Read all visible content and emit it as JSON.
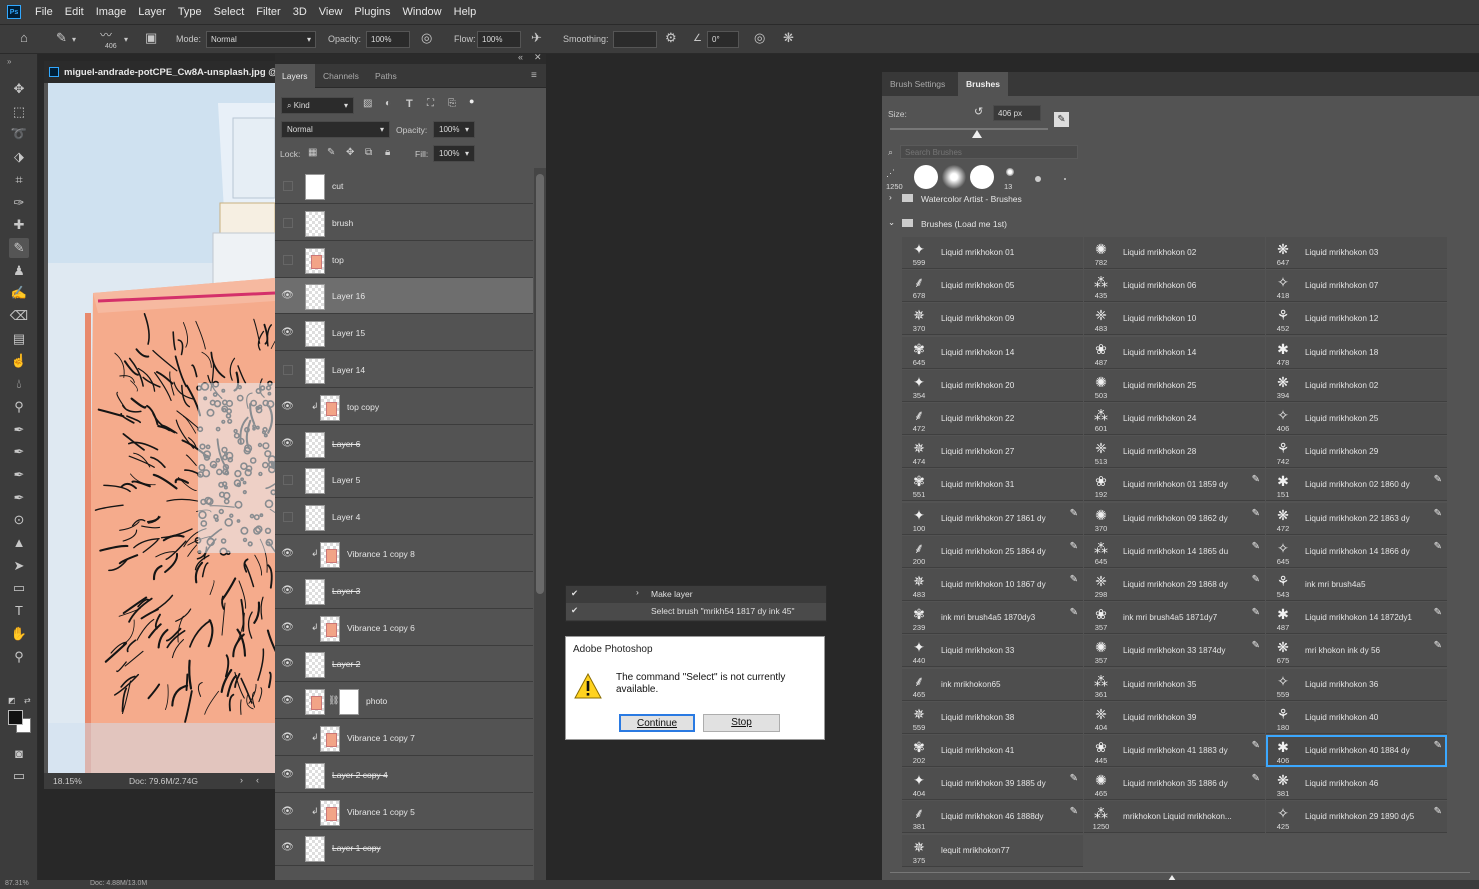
{
  "menubar": {
    "logo": "Ps",
    "items": [
      "File",
      "Edit",
      "Image",
      "Layer",
      "Type",
      "Select",
      "Filter",
      "3D",
      "View",
      "Plugins",
      "Window",
      "Help"
    ]
  },
  "options": {
    "brush_size": "406",
    "mode_label": "Mode:",
    "mode_value": "Normal",
    "opacity_label": "Opacity:",
    "opacity_value": "100%",
    "flow_label": "Flow:",
    "flow_value": "100%",
    "smoothing_label": "Smoothing:",
    "smoothing_value": "",
    "angle_value": "0°"
  },
  "document": {
    "tab_title": "miguel-andrade-potCPE_Cw8A-unsplash.jpg @",
    "zoom": "18.15%",
    "doc_size": "Doc: 79.6M/2.74G",
    "colors": {
      "canvas_bg": "#dfe9f2",
      "bottle": "#f5ab8c",
      "ink": "#151515"
    }
  },
  "layers_panel": {
    "tabs": [
      "Layers",
      "Channels",
      "Paths"
    ],
    "kind_filter": "Kind",
    "blend_mode": "Normal",
    "opacity_label": "Opacity:",
    "opacity_value": "100%",
    "lock_label": "Lock:",
    "fill_label": "Fill:",
    "fill_value": "100%",
    "layers": [
      {
        "name": "cut",
        "visible": false,
        "thumb": "white",
        "clip": false,
        "strike": false
      },
      {
        "name": "brush",
        "visible": false,
        "thumb": "checker",
        "clip": false,
        "strike": false
      },
      {
        "name": "top",
        "visible": false,
        "thumb": "peach",
        "clip": false,
        "strike": false
      },
      {
        "name": "Layer 16",
        "visible": true,
        "thumb": "checker",
        "clip": false,
        "strike": false,
        "selected": true
      },
      {
        "name": "Layer 15",
        "visible": true,
        "thumb": "checker",
        "clip": false,
        "strike": false
      },
      {
        "name": "Layer 14",
        "visible": false,
        "thumb": "checker",
        "clip": false,
        "strike": false
      },
      {
        "name": "top copy",
        "visible": true,
        "thumb": "peach",
        "clip": true,
        "strike": false
      },
      {
        "name": "Layer 6",
        "visible": true,
        "thumb": "checker",
        "clip": false,
        "strike": true
      },
      {
        "name": "Layer 5",
        "visible": false,
        "thumb": "checker",
        "clip": false,
        "strike": false
      },
      {
        "name": "Layer 4",
        "visible": false,
        "thumb": "checker",
        "clip": false,
        "strike": false
      },
      {
        "name": "Vibrance 1 copy 8",
        "visible": true,
        "thumb": "peach",
        "clip": true,
        "strike": false
      },
      {
        "name": "Layer 3",
        "visible": true,
        "thumb": "checker",
        "clip": false,
        "strike": true
      },
      {
        "name": "Vibrance 1 copy 6",
        "visible": true,
        "thumb": "peach",
        "clip": true,
        "strike": false
      },
      {
        "name": "Layer 2",
        "visible": true,
        "thumb": "checker",
        "clip": false,
        "strike": true
      },
      {
        "name": "photo",
        "visible": true,
        "thumb": "peach",
        "clip": false,
        "strike": false,
        "mask": true
      },
      {
        "name": "Vibrance 1 copy 7",
        "visible": true,
        "thumb": "peach",
        "clip": true,
        "strike": false
      },
      {
        "name": "Layer 2 copy 4",
        "visible": true,
        "thumb": "checker",
        "clip": false,
        "strike": true
      },
      {
        "name": "Vibrance 1 copy 5",
        "visible": true,
        "thumb": "peach",
        "clip": true,
        "strike": false
      },
      {
        "name": "Layer 1 copy",
        "visible": true,
        "thumb": "checker",
        "clip": false,
        "strike": true
      }
    ]
  },
  "history": {
    "rows": [
      "Make layer",
      "Select brush \"mrikh54 1817 dy ink 45\""
    ]
  },
  "dialog": {
    "title": "Adobe Photoshop",
    "message": "The command \"Select\" is not currently available.",
    "continue_label": "Continue",
    "stop_label": "Stop"
  },
  "brushes_panel": {
    "tabs": [
      "Brush Settings",
      "Brushes"
    ],
    "size_label": "Size:",
    "size_value": "406 px",
    "size_fraction": 0.55,
    "search_placeholder": "Search Brushes",
    "preset_sizes": [
      "1250",
      "13"
    ],
    "folders": [
      "Watercolor Artist - Brushes",
      "Brushes (Load me 1st)"
    ],
    "brushes": [
      {
        "size": "599",
        "name": "Liquid mrikhokon 01"
      },
      {
        "size": "782",
        "name": "Liquid mrikhokon 02"
      },
      {
        "size": "647",
        "name": "Liquid mrikhokon 03"
      },
      {
        "size": "678",
        "name": "Liquid mrikhokon 05"
      },
      {
        "size": "435",
        "name": "Liquid mrikhokon 06"
      },
      {
        "size": "418",
        "name": "Liquid mrikhokon 07"
      },
      {
        "size": "370",
        "name": "Liquid mrikhokon 09"
      },
      {
        "size": "483",
        "name": "Liquid mrikhokon 10"
      },
      {
        "size": "452",
        "name": "Liquid mrikhokon 12"
      },
      {
        "size": "645",
        "name": "Liquid mrikhokon 14"
      },
      {
        "size": "487",
        "name": "Liquid mrikhokon 14"
      },
      {
        "size": "478",
        "name": "Liquid mrikhokon 18"
      },
      {
        "size": "354",
        "name": "Liquid mrikhokon 20"
      },
      {
        "size": "503",
        "name": "Liquid mrikhokon 25"
      },
      {
        "size": "394",
        "name": "Liquid mrikhokon 02"
      },
      {
        "size": "472",
        "name": "Liquid mrikhokon 22"
      },
      {
        "size": "601",
        "name": "Liquid mrikhokon 24"
      },
      {
        "size": "406",
        "name": "Liquid mrikhokon 25"
      },
      {
        "size": "474",
        "name": "Liquid mrikhokon 27"
      },
      {
        "size": "513",
        "name": "Liquid mrikhokon 28"
      },
      {
        "size": "742",
        "name": "Liquid mrikhokon 29"
      },
      {
        "size": "551",
        "name": "Liquid mrikhokon 31"
      },
      {
        "size": "192",
        "name": "Liquid mrikhokon 01 1859 dy",
        "edit": true
      },
      {
        "size": "151",
        "name": "Liquid mrikhokon 02 1860 dy",
        "edit": true
      },
      {
        "size": "100",
        "name": "Liquid mrikhokon 27 1861 dy",
        "edit": true
      },
      {
        "size": "370",
        "name": "Liquid mrikhokon 09 1862 dy",
        "edit": true
      },
      {
        "size": "472",
        "name": "Liquid mrikhokon 22 1863 dy",
        "edit": true
      },
      {
        "size": "200",
        "name": "Liquid mrikhokon 25 1864 dy",
        "edit": true
      },
      {
        "size": "645",
        "name": "Liquid mrikhokon 14 1865 du",
        "edit": true
      },
      {
        "size": "645",
        "name": "Liquid mrikhokon 14 1866 dy",
        "edit": true
      },
      {
        "size": "483",
        "name": "Liquid mrikhokon 10 1867 dy",
        "edit": true
      },
      {
        "size": "298",
        "name": "Liquid mrikhokon 29 1868 dy",
        "edit": true
      },
      {
        "size": "543",
        "name": "ink mri brush4a5"
      },
      {
        "size": "239",
        "name": "ink mri brush4a5 1870dy3",
        "edit": true
      },
      {
        "size": "357",
        "name": "ink mri brush4a5 1871dy7",
        "edit": true
      },
      {
        "size": "487",
        "name": "Liquid mrikhokon 14 1872dy1",
        "edit": true
      },
      {
        "size": "440",
        "name": "Liquid mrikhokon 33"
      },
      {
        "size": "357",
        "name": "Liquid mrikhokon 33 1874dy",
        "edit": true
      },
      {
        "size": "675",
        "name": "mri khokon ink dy 56",
        "edit": true
      },
      {
        "size": "465",
        "name": "ink mrikhokon65"
      },
      {
        "size": "361",
        "name": "Liquid mrikhokon 35"
      },
      {
        "size": "559",
        "name": "Liquid mrikhokon 36"
      },
      {
        "size": "559",
        "name": "Liquid mrikhokon 38"
      },
      {
        "size": "404",
        "name": "Liquid mrikhokon 39"
      },
      {
        "size": "180",
        "name": "Liquid mrikhokon 40"
      },
      {
        "size": "202",
        "name": "Liquid mrikhokon 41"
      },
      {
        "size": "445",
        "name": "Liquid mrikhokon 41 1883 dy",
        "edit": true
      },
      {
        "size": "406",
        "name": "Liquid mrikhokon 40 1884 dy",
        "edit": true,
        "selected": true
      },
      {
        "size": "404",
        "name": "Liquid mrikhokon 39 1885 dy",
        "edit": true
      },
      {
        "size": "465",
        "name": "Liquid mrikhokon 35 1886 dy",
        "edit": true
      },
      {
        "size": "381",
        "name": "Liquid mrikhokon 46"
      },
      {
        "size": "381",
        "name": "Liquid mrikhokon 46 1888dy",
        "edit": true
      },
      {
        "size": "1250",
        "name": "mrikhokon Liquid mrikhokon..."
      },
      {
        "size": "425",
        "name": "Liquid mrikhokon 29 1890 dy5",
        "edit": true
      },
      {
        "size": "375",
        "name": "lequit mrikhokon77"
      }
    ]
  },
  "bottom_status": {
    "zoom": "87.31%",
    "doc": "Doc: 4.88M/13.0M"
  }
}
